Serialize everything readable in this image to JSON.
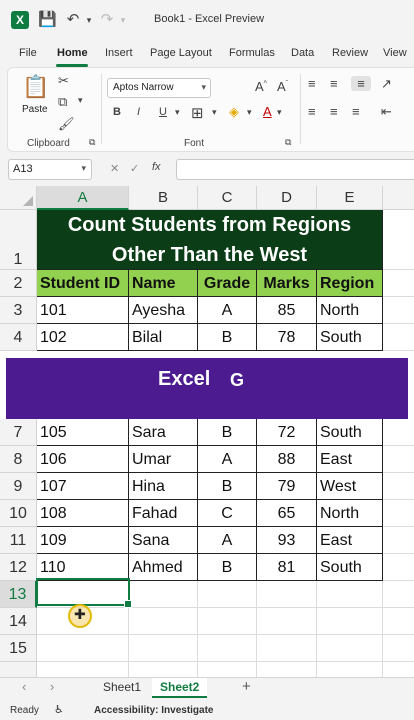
{
  "titlebar": {
    "doc_title": "Book1 - Excel Preview",
    "icons": [
      "excel-logo",
      "save-icon",
      "undo-icon",
      "redo-icon"
    ]
  },
  "tabs": [
    "File",
    "Home",
    "Insert",
    "Page Layout",
    "Formulas",
    "Data",
    "Review",
    "View"
  ],
  "active_tab": "Home",
  "ribbon": {
    "clipboard": {
      "paste_label": "Paste",
      "group_label": "Clipboard"
    },
    "font": {
      "font_name": "Aptos Narrow",
      "font_size": "",
      "group_label": "Font"
    }
  },
  "formula_bar": {
    "name_box": "A13",
    "formula": ""
  },
  "columns": [
    "A",
    "B",
    "C",
    "D",
    "E"
  ],
  "rows": [
    "1",
    "2",
    "3",
    "4",
    "7",
    "8",
    "9",
    "10",
    "11",
    "12",
    "13",
    "14",
    "15"
  ],
  "sheet": {
    "title_line1": "Count Students from Regions",
    "title_line2": "Other Than the West",
    "headers": [
      "Student ID",
      "Name",
      "Grade",
      "Marks",
      "Region"
    ],
    "records": [
      [
        "101",
        "Ayesha",
        "A",
        "85",
        "North"
      ],
      [
        "102",
        "Bilal",
        "B",
        "78",
        "South"
      ],
      [
        "105",
        "Sara",
        "B",
        "72",
        "South"
      ],
      [
        "106",
        "Umar",
        "A",
        "88",
        "East"
      ],
      [
        "107",
        "Hina",
        "B",
        "79",
        "West"
      ],
      [
        "108",
        "Fahad",
        "C",
        "65",
        "North"
      ],
      [
        "109",
        "Sana",
        "A",
        "93",
        "East"
      ],
      [
        "110",
        "Ahmed",
        "B",
        "81",
        "South"
      ]
    ]
  },
  "banner": {
    "text": "Excel",
    "mark": "G"
  },
  "sheet_tabs": [
    "Sheet1",
    "Sheet2"
  ],
  "active_sheet": "Sheet2",
  "status": {
    "ready": "Ready",
    "accessibility": "Accessibility: Investigate"
  },
  "colors": {
    "excel_green": "#107c41",
    "title_fill": "#0b3d17",
    "header_fill": "#92d050",
    "banner_fill": "#4b1b8f"
  }
}
